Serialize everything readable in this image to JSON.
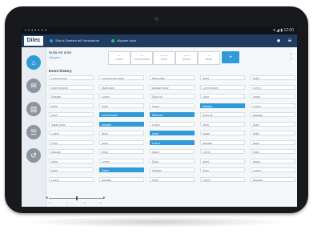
{
  "status_bar": {
    "left": "▪ ▪ ▪ ▪ ▪ ▪ ▪",
    "right": "▾ ◢ ▮ 12:00"
  },
  "app": {
    "brand": "Dilec",
    "crumbs": [
      {
        "text": "Sint ut Omnem ad Formularum",
        "color": "#2f9bd8"
      },
      {
        "text": "Aliquam dolor",
        "color": "#2fbf6b"
      }
    ],
    "top_icons": [
      "person-icon",
      "menu-icon"
    ]
  },
  "sidebar": {
    "items": [
      {
        "icon": "home-icon",
        "glyph": "⌂",
        "active": true
      },
      {
        "icon": "message-icon",
        "glyph": "✉",
        "active": false
      },
      {
        "icon": "document-icon",
        "glyph": "▤",
        "active": false
      },
      {
        "icon": "chat-icon",
        "glyph": "☰",
        "active": false
      },
      {
        "icon": "history-icon",
        "glyph": "↺",
        "active": false
      }
    ]
  },
  "patient": {
    "name": "Nulla est dolor",
    "sub": "Aliquam"
  },
  "status_tiles": [
    {
      "value": "—",
      "label": "Lorem"
    },
    {
      "value": "—",
      "label": "Lorem ipsum"
    },
    {
      "value": "— / —",
      "label": "Dolor"
    },
    {
      "value": "—  —",
      "label": "Ipsum"
    },
    {
      "value": "—",
      "label": "Nulla"
    }
  ],
  "add_button": "+",
  "section_title": "Event history",
  "cells": [
    [
      "Lorem ipsum",
      "Lorem ipsum dolor",
      "Nulla vitae",
      "Amet",
      "Nulla"
    ],
    [
      "Dolor sit amet",
      "Nulla dolor",
      "Aliquam dolor",
      "Lorem ipsum",
      "Lorem"
    ],
    [
      "Aliquam",
      "Lorem",
      "Dolor sit",
      "Dolor",
      "Ipsum"
    ],
    [
      "Nulla",
      "Dolor",
      "Ipsum",
      "Aliquam",
      "Lorem"
    ],
    [
      "Amet",
      "Lorem ipsum",
      "Nulla est",
      "Dolor sit",
      "Aliquam"
    ],
    [
      "Ipsum dolor",
      "Aliquam",
      "Lorem",
      "Nulla",
      "Dolor"
    ],
    [
      "Lorem",
      "Nulla",
      "Amet",
      "Ipsum",
      "Nulla"
    ],
    [
      "Dolor",
      "Amet",
      "Lorem",
      "Aliquam",
      "Amet"
    ],
    [
      "Aliquam",
      "Dolor",
      "Ipsum",
      "Lorem",
      "Dolor"
    ],
    [
      "Nulla",
      "Lorem",
      "Dolor",
      "Amet",
      "Ipsum"
    ],
    [
      "Amet",
      "Ipsum",
      "Aliquam",
      "Dolor",
      "Lorem"
    ],
    [
      "Lorem",
      "Aliquam",
      "Nulla",
      "Lorem",
      "Aliquam"
    ]
  ],
  "selected_cells": [
    [
      4,
      1
    ],
    [
      5,
      1
    ],
    [
      10,
      1
    ],
    [
      4,
      2
    ],
    [
      6,
      2
    ],
    [
      7,
      2
    ],
    [
      3,
      3
    ]
  ],
  "slider": {
    "labels": [
      "0",
      "1",
      "2",
      "3"
    ],
    "value": 0.5
  }
}
